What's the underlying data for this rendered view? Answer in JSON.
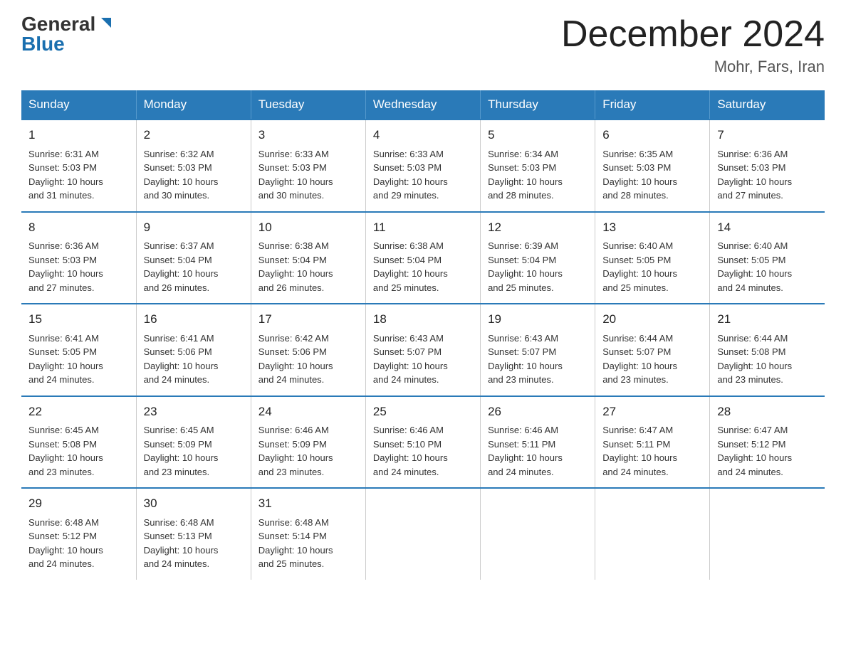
{
  "logo": {
    "line1_black": "General",
    "line1_blue": "Blue",
    "line2": "Blue"
  },
  "header": {
    "title": "December 2024",
    "location": "Mohr, Fars, Iran"
  },
  "weekdays": [
    "Sunday",
    "Monday",
    "Tuesday",
    "Wednesday",
    "Thursday",
    "Friday",
    "Saturday"
  ],
  "weeks": [
    [
      {
        "day": "1",
        "info": "Sunrise: 6:31 AM\nSunset: 5:03 PM\nDaylight: 10 hours\nand 31 minutes."
      },
      {
        "day": "2",
        "info": "Sunrise: 6:32 AM\nSunset: 5:03 PM\nDaylight: 10 hours\nand 30 minutes."
      },
      {
        "day": "3",
        "info": "Sunrise: 6:33 AM\nSunset: 5:03 PM\nDaylight: 10 hours\nand 30 minutes."
      },
      {
        "day": "4",
        "info": "Sunrise: 6:33 AM\nSunset: 5:03 PM\nDaylight: 10 hours\nand 29 minutes."
      },
      {
        "day": "5",
        "info": "Sunrise: 6:34 AM\nSunset: 5:03 PM\nDaylight: 10 hours\nand 28 minutes."
      },
      {
        "day": "6",
        "info": "Sunrise: 6:35 AM\nSunset: 5:03 PM\nDaylight: 10 hours\nand 28 minutes."
      },
      {
        "day": "7",
        "info": "Sunrise: 6:36 AM\nSunset: 5:03 PM\nDaylight: 10 hours\nand 27 minutes."
      }
    ],
    [
      {
        "day": "8",
        "info": "Sunrise: 6:36 AM\nSunset: 5:03 PM\nDaylight: 10 hours\nand 27 minutes."
      },
      {
        "day": "9",
        "info": "Sunrise: 6:37 AM\nSunset: 5:04 PM\nDaylight: 10 hours\nand 26 minutes."
      },
      {
        "day": "10",
        "info": "Sunrise: 6:38 AM\nSunset: 5:04 PM\nDaylight: 10 hours\nand 26 minutes."
      },
      {
        "day": "11",
        "info": "Sunrise: 6:38 AM\nSunset: 5:04 PM\nDaylight: 10 hours\nand 25 minutes."
      },
      {
        "day": "12",
        "info": "Sunrise: 6:39 AM\nSunset: 5:04 PM\nDaylight: 10 hours\nand 25 minutes."
      },
      {
        "day": "13",
        "info": "Sunrise: 6:40 AM\nSunset: 5:05 PM\nDaylight: 10 hours\nand 25 minutes."
      },
      {
        "day": "14",
        "info": "Sunrise: 6:40 AM\nSunset: 5:05 PM\nDaylight: 10 hours\nand 24 minutes."
      }
    ],
    [
      {
        "day": "15",
        "info": "Sunrise: 6:41 AM\nSunset: 5:05 PM\nDaylight: 10 hours\nand 24 minutes."
      },
      {
        "day": "16",
        "info": "Sunrise: 6:41 AM\nSunset: 5:06 PM\nDaylight: 10 hours\nand 24 minutes."
      },
      {
        "day": "17",
        "info": "Sunrise: 6:42 AM\nSunset: 5:06 PM\nDaylight: 10 hours\nand 24 minutes."
      },
      {
        "day": "18",
        "info": "Sunrise: 6:43 AM\nSunset: 5:07 PM\nDaylight: 10 hours\nand 24 minutes."
      },
      {
        "day": "19",
        "info": "Sunrise: 6:43 AM\nSunset: 5:07 PM\nDaylight: 10 hours\nand 23 minutes."
      },
      {
        "day": "20",
        "info": "Sunrise: 6:44 AM\nSunset: 5:07 PM\nDaylight: 10 hours\nand 23 minutes."
      },
      {
        "day": "21",
        "info": "Sunrise: 6:44 AM\nSunset: 5:08 PM\nDaylight: 10 hours\nand 23 minutes."
      }
    ],
    [
      {
        "day": "22",
        "info": "Sunrise: 6:45 AM\nSunset: 5:08 PM\nDaylight: 10 hours\nand 23 minutes."
      },
      {
        "day": "23",
        "info": "Sunrise: 6:45 AM\nSunset: 5:09 PM\nDaylight: 10 hours\nand 23 minutes."
      },
      {
        "day": "24",
        "info": "Sunrise: 6:46 AM\nSunset: 5:09 PM\nDaylight: 10 hours\nand 23 minutes."
      },
      {
        "day": "25",
        "info": "Sunrise: 6:46 AM\nSunset: 5:10 PM\nDaylight: 10 hours\nand 24 minutes."
      },
      {
        "day": "26",
        "info": "Sunrise: 6:46 AM\nSunset: 5:11 PM\nDaylight: 10 hours\nand 24 minutes."
      },
      {
        "day": "27",
        "info": "Sunrise: 6:47 AM\nSunset: 5:11 PM\nDaylight: 10 hours\nand 24 minutes."
      },
      {
        "day": "28",
        "info": "Sunrise: 6:47 AM\nSunset: 5:12 PM\nDaylight: 10 hours\nand 24 minutes."
      }
    ],
    [
      {
        "day": "29",
        "info": "Sunrise: 6:48 AM\nSunset: 5:12 PM\nDaylight: 10 hours\nand 24 minutes."
      },
      {
        "day": "30",
        "info": "Sunrise: 6:48 AM\nSunset: 5:13 PM\nDaylight: 10 hours\nand 24 minutes."
      },
      {
        "day": "31",
        "info": "Sunrise: 6:48 AM\nSunset: 5:14 PM\nDaylight: 10 hours\nand 25 minutes."
      },
      {
        "day": "",
        "info": ""
      },
      {
        "day": "",
        "info": ""
      },
      {
        "day": "",
        "info": ""
      },
      {
        "day": "",
        "info": ""
      }
    ]
  ]
}
